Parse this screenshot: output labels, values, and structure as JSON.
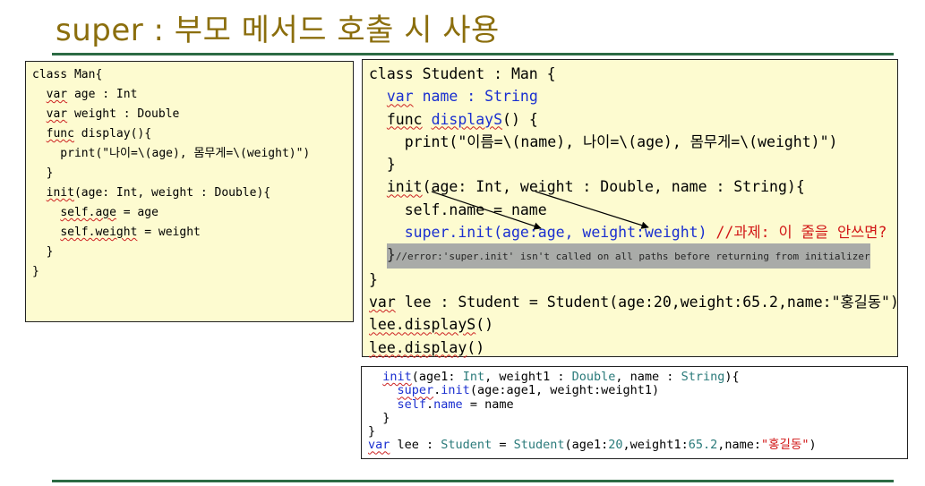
{
  "title": "super : 부모 메서드 호출 시 사용",
  "left_code": {
    "l1": "class Man{",
    "l2_kw": "var",
    "l2_rest": " age : Int",
    "l3_kw": "var",
    "l3_rest": " weight : Double",
    "l4_kw": "func",
    "l4_rest": " display(){",
    "l5": "    print(\"나이=\\(age), 몸무게=\\(weight)\")",
    "l6": "  }",
    "l7_kw": "init",
    "l7_rest": "(age: Int, weight : Double){",
    "l8_a": "self.age",
    "l8_b": " = age",
    "l9_a": "self.weight",
    "l9_b": " = weight",
    "l10": "  }",
    "l11": "}"
  },
  "right_code": {
    "l1": "class Student : Man {",
    "l2_a": "var",
    "l2_b": " name : String",
    "l3_a": "func",
    "l3_b": "displayS",
    "l3_c": "() {",
    "l4": "    print(\"이름=\\(name), 나이=\\(age), 몸무게=\\(weight)\")",
    "l5": "  }",
    "l6_a": "init",
    "l6_b": "(age: Int, weight : Double, name : String){",
    "l7": "    self.name = name",
    "l8_a": "super.init(age:age, weight:weight)",
    "l8_b": " //과제: 이 줄을 안쓰면?",
    "l9_a": "}",
    "l9_b": "//error:'super.init' isn't called on all paths before returning from initializer",
    "l10": "}",
    "l11_a": "var",
    "l11_b": " lee : Student = Student(age:20,weight:65.2,name:\"홍길동\")",
    "l12_a": "lee.displayS",
    "l12_b": "()",
    "l13_a": "lee.display",
    "l13_b": "()"
  },
  "bottom_code": {
    "l1_a": "init",
    "l1_b": "(age1: ",
    "l1_c": "Int",
    "l1_d": ", weight1 : ",
    "l1_e": "Double",
    "l1_f": ", name : ",
    "l1_g": "String",
    "l1_h": "){",
    "l2_a": "super",
    "l2_b": ".",
    "l2_c": "init",
    "l2_d": "(age:age1, weight:weight1)",
    "l3_a": "self",
    "l3_b": ".",
    "l3_c": "name",
    "l3_d": " = name",
    "l4": "  }",
    "l5": "}",
    "l6_a": "var",
    "l6_b": " lee : ",
    "l6_c": "Student",
    "l6_d": " = ",
    "l6_e": "Student",
    "l6_f": "(age1:",
    "l6_g": "20",
    "l6_h": ",weight1:",
    "l6_i": "65.2",
    "l6_j": ",name:",
    "l6_k": "\"홍길동\"",
    "l6_l": ")"
  },
  "colors": {
    "title": "#8b6e0d",
    "rule": "#2c6b44",
    "box_bg": "#fdfbd0",
    "keyword_blue": "#1a2fd0",
    "type_teal": "#2a7a7a",
    "comment_red": "#d11616",
    "error_bg": "#a9aba8"
  }
}
